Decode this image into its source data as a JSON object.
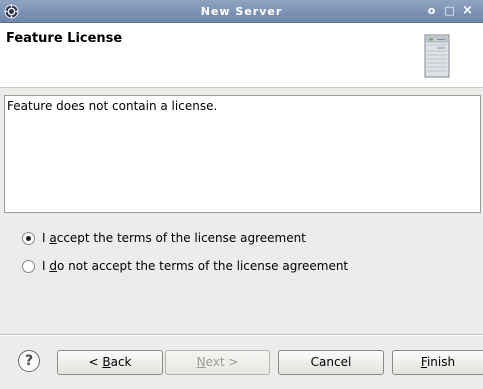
{
  "window": {
    "title": "New Server",
    "controls": {
      "minimize": "o",
      "maximize": "□",
      "close": "×"
    }
  },
  "banner": {
    "heading": "Feature License",
    "icon": "server-icon"
  },
  "license": {
    "text": "Feature does not contain a license."
  },
  "options": [
    {
      "pre": "I ",
      "accel": "a",
      "post": "ccept the terms of the license agreement",
      "selected": true
    },
    {
      "pre": "I ",
      "accel": "d",
      "post": "o not accept the terms of the license agreement",
      "selected": false
    }
  ],
  "buttons": {
    "help": "?",
    "back": {
      "pre": "< ",
      "accel": "B",
      "post": "ack",
      "enabled": true
    },
    "next": {
      "pre": "",
      "accel": "N",
      "post": "ext >",
      "enabled": false
    },
    "cancel": {
      "label": "Cancel",
      "enabled": true
    },
    "finish": {
      "pre": "",
      "accel": "F",
      "post": "inish",
      "enabled": true
    }
  }
}
